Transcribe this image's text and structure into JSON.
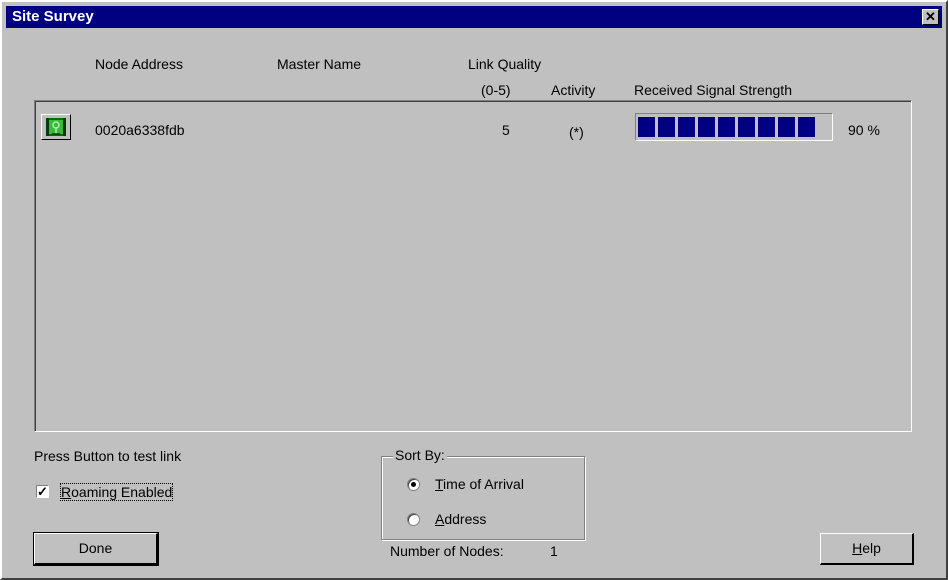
{
  "window": {
    "title": "Site Survey",
    "close_glyph": "✕"
  },
  "columns": {
    "node_address": "Node Address",
    "master_name": "Master Name",
    "link_quality_top": "Link Quality",
    "link_quality_range": "(0-5)",
    "activity": "Activity",
    "signal": "Received Signal Strength"
  },
  "nodes": [
    {
      "icon": "network-node-icon",
      "address": "0020a6338fdb",
      "master_name": "",
      "link_quality": "5",
      "activity": "(*)",
      "signal_percent": 90,
      "signal_label": "90 %"
    }
  ],
  "footer": {
    "test_hint": "Press Button to test link",
    "roaming_label": "Roaming Enabled",
    "roaming_checked": true,
    "sort_by_label": "Sort By:",
    "sort_options": [
      "Time of Arrival",
      "Address"
    ],
    "sort_selected": "Time of Arrival",
    "node_count_label": "Number of Nodes:",
    "node_count": "1",
    "done_label": "Done",
    "help_label": "Help"
  },
  "colors": {
    "title_bar": "#000080",
    "signal_fill": "#000080",
    "face": "#c0c0c0"
  }
}
